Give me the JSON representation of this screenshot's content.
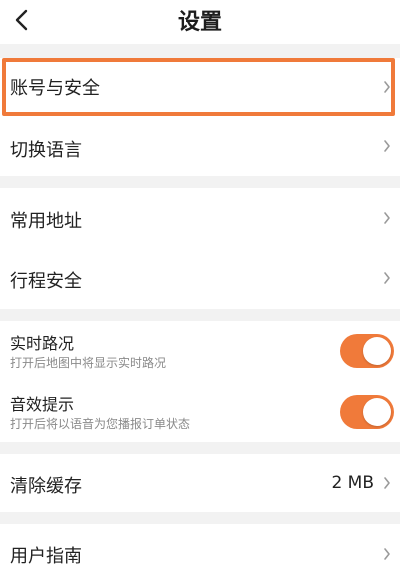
{
  "header": {
    "title": "设置"
  },
  "colors": {
    "accent": "#f07a3a",
    "background": "#f2f2f2",
    "highlight_border": "#f07a3a"
  },
  "groups": {
    "account": {
      "items": [
        {
          "label": "账号与安全"
        },
        {
          "label": "切换语言"
        }
      ]
    },
    "places": {
      "items": [
        {
          "label": "常用地址"
        },
        {
          "label": "行程安全"
        }
      ]
    },
    "toggles": {
      "items": [
        {
          "label": "实时路况",
          "description": "打开后地图中将显示实时路况",
          "enabled": true
        },
        {
          "label": "音效提示",
          "description": "打开后将以语音为您播报订单状态",
          "enabled": true
        }
      ]
    },
    "cache": {
      "label": "清除缓存",
      "value": "2 MB"
    },
    "help": {
      "label": "用户指南"
    }
  },
  "icons": {
    "back": "chevron-left-icon",
    "row_arrow": "chevron-right-icon"
  }
}
